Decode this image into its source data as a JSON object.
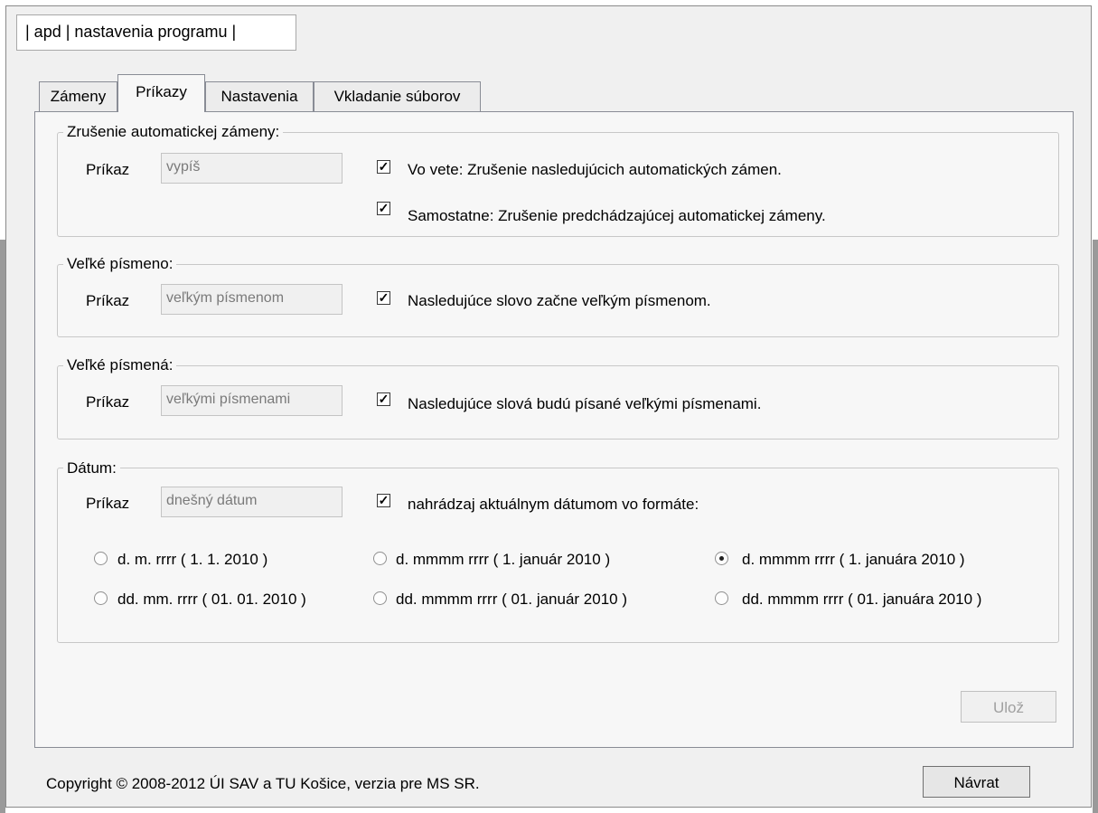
{
  "window": {
    "title": "| apd | nastavenia programu |"
  },
  "tabs": [
    {
      "label": "Zámeny",
      "active": false
    },
    {
      "label": "Príkazy",
      "active": true
    },
    {
      "label": "Nastavenia",
      "active": false
    },
    {
      "label": "Vkladanie súborov",
      "active": false
    }
  ],
  "groups": {
    "cancel_auto": {
      "legend": "Zrušenie automatickej zámeny:",
      "command_label": "Príkaz",
      "command_value": "vypíš",
      "checkboxes": [
        {
          "label": "Vo vete: Zrušenie nasledujúcich automatických zámen.",
          "checked": true
        },
        {
          "label": "Samostatne: Zrušenie predchádzajúcej automatickej zámeny.",
          "checked": true
        }
      ]
    },
    "capital_letter": {
      "legend": "Veľké písmeno:",
      "command_label": "Príkaz",
      "command_value": "veľkým písmenom",
      "checkbox": {
        "label": "Nasledujúce slovo začne veľkým písmenom.",
        "checked": true
      }
    },
    "capital_letters": {
      "legend": "Veľké písmená:",
      "command_label": "Príkaz",
      "command_value": "veľkými písmenami",
      "checkbox": {
        "label": "Nasledujúce slová budú písané veľkými písmenami.",
        "checked": true
      }
    },
    "date": {
      "legend": "Dátum:",
      "command_label": "Príkaz",
      "command_value": "dnešný dátum",
      "checkbox": {
        "label": "nahrádzaj aktuálnym dátumom vo formáte:",
        "checked": true
      },
      "formats": [
        {
          "label": "d. m. rrrr ( 1. 1. 2010 )",
          "selected": false
        },
        {
          "label": "d. mmmm rrrr ( 1. január 2010 )",
          "selected": false
        },
        {
          "label": "d. mmmm rrrr ( 1. januára 2010 )",
          "selected": true
        },
        {
          "label": "dd. mm. rrrr ( 01. 01. 2010 )",
          "selected": false
        },
        {
          "label": "dd. mmmm rrrr ( 01. január 2010 )",
          "selected": false
        },
        {
          "label": "dd. mmmm rrrr ( 01. januára 2010 )",
          "selected": false
        }
      ]
    }
  },
  "buttons": {
    "save": "Ulož",
    "back": "Návrat"
  },
  "footer": {
    "copyright": "Copyright © 2008-2012 ÚI SAV a TU Košice, verzia pre MS SR."
  },
  "colors": {
    "window_bg": "#f0f0f0",
    "tab_page_bg": "#f7f7f7",
    "disabled_text": "#a0a0a0"
  }
}
